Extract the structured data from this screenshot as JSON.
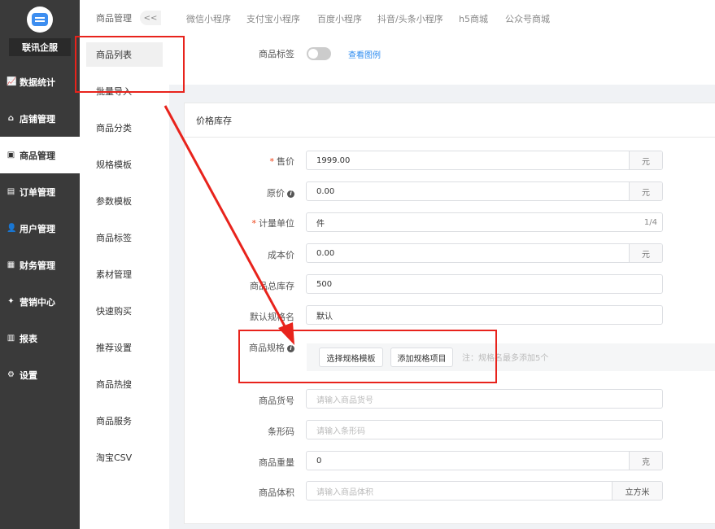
{
  "sidebar": {
    "brand": "联讯企服",
    "items": [
      {
        "label": "数据统计",
        "icon": "chart-icon",
        "glyph": "📈"
      },
      {
        "label": "店铺管理",
        "icon": "shop-icon",
        "glyph": "⌂"
      },
      {
        "label": "商品管理",
        "icon": "product-icon",
        "glyph": "▣"
      },
      {
        "label": "订单管理",
        "icon": "order-icon",
        "glyph": "▤"
      },
      {
        "label": "用户管理",
        "icon": "user-icon",
        "glyph": "👤"
      },
      {
        "label": "财务管理",
        "icon": "finance-icon",
        "glyph": "▦"
      },
      {
        "label": "营销中心",
        "icon": "marketing-icon",
        "glyph": "✦"
      },
      {
        "label": "报表",
        "icon": "report-icon",
        "glyph": "▥"
      },
      {
        "label": "设置",
        "icon": "settings-icon",
        "glyph": "⚙"
      }
    ]
  },
  "submenu": {
    "header": "商品管理",
    "collapse": "<<",
    "items": [
      "商品列表",
      "批量导入",
      "商品分类",
      "规格模板",
      "参数模板",
      "商品标签",
      "素材管理",
      "快速购买",
      "推荐设置",
      "商品热搜",
      "商品服务",
      "淘宝CSV"
    ]
  },
  "tabs": [
    "微信小程序",
    "支付宝小程序",
    "百度小程序",
    "抖音/头条小程序",
    "h5商城",
    "公众号商城"
  ],
  "top": {
    "tag_label": "商品标签",
    "view_example": "查看图例"
  },
  "section": {
    "title": "价格库存",
    "fields": {
      "price": {
        "label": "售价",
        "value": "1999.00",
        "suffix": "元"
      },
      "original_price": {
        "label": "原价",
        "value": "0.00",
        "suffix": "元"
      },
      "unit": {
        "label": "计量单位",
        "value": "件",
        "count": "1/4"
      },
      "cost": {
        "label": "成本价",
        "value": "0.00",
        "suffix": "元"
      },
      "stock": {
        "label": "商品总库存",
        "value": "500"
      },
      "spec_name": {
        "label": "默认规格名",
        "value": "默认"
      },
      "spec": {
        "label": "商品规格",
        "select_btn": "选择规格模板",
        "add_btn": "添加规格项目",
        "note": "注：规格名最多添加5个"
      },
      "sku": {
        "label": "商品货号",
        "placeholder": "请输入商品货号"
      },
      "barcode": {
        "label": "条形码",
        "placeholder": "请输入条形码"
      },
      "weight": {
        "label": "商品重量",
        "value": "0",
        "suffix": "克"
      },
      "volume": {
        "label": "商品体积",
        "placeholder": "请输入商品体积",
        "suffix": "立方米"
      }
    }
  }
}
